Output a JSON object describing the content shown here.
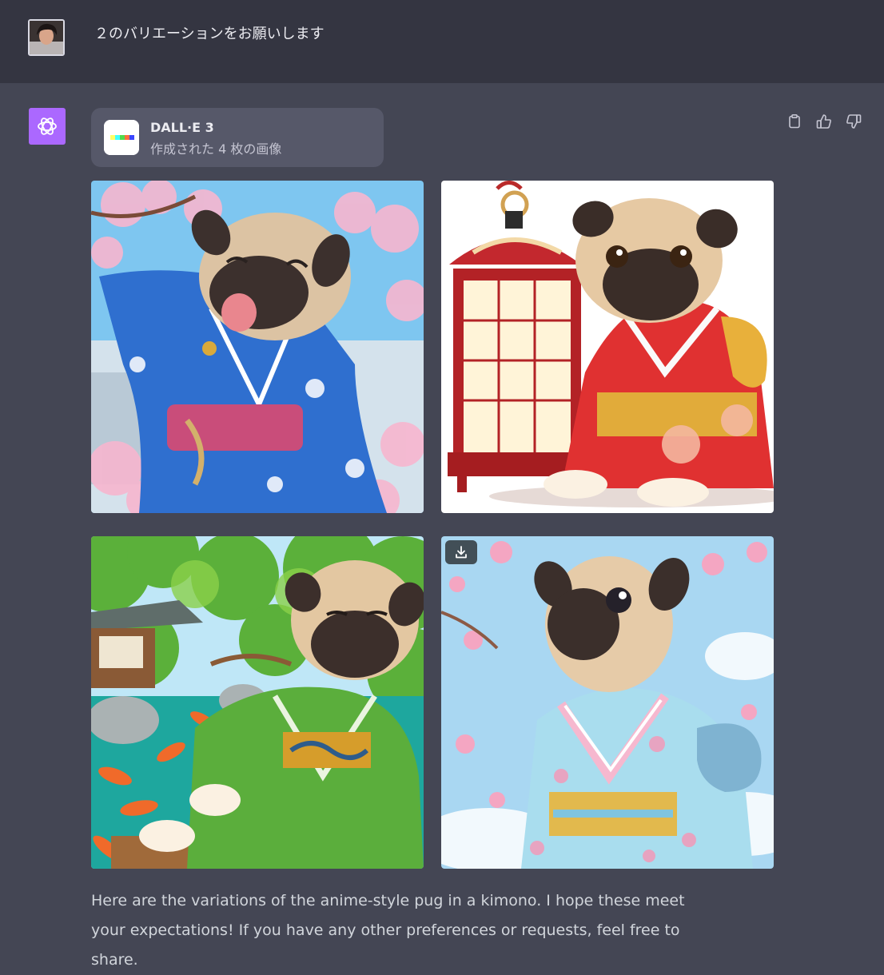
{
  "user_message": {
    "text": "２のバリエーションをお願いします",
    "avatar": "user-photo-avatar"
  },
  "assistant": {
    "avatar": "openai-logo-icon",
    "accent_color": "#ab68ff",
    "tool_card": {
      "name": "DALL·E 3",
      "subtitle": "作成された 4 枚の画像",
      "icon": "dalle-color-bar-icon"
    },
    "actions": [
      {
        "icon": "clipboard-icon"
      },
      {
        "icon": "thumbs-up-icon"
      },
      {
        "icon": "thumbs-down-icon"
      }
    ],
    "images": [
      {
        "subject": "laughing pug in blue kimono with cherry blossoms"
      },
      {
        "subject": "pug in red kimono beside a red lantern"
      },
      {
        "subject": "pug in green kimono by a koi pond garden"
      },
      {
        "subject": "pug in pastel kimono looking up at cherry blossoms",
        "download_icon": "download-icon"
      }
    ],
    "response_text": "Here are the variations of the anime-style pug in a kimono. I hope these meet your expectations! If you have any other preferences or requests, feel free to share."
  },
  "colors": {
    "background": "#444654",
    "user_row": "#343541",
    "tool_card": "#565869"
  }
}
